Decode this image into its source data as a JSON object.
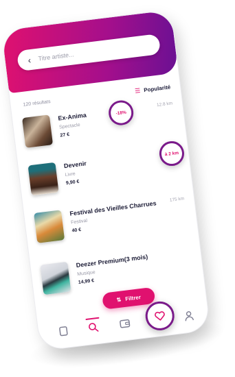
{
  "search": {
    "placeholder": "Titre artiste..."
  },
  "results": {
    "count": "120 résultats"
  },
  "sort": {
    "label": "Popularité"
  },
  "items": [
    {
      "title": "Ex-Anima",
      "category": "Spectacle",
      "price": "27 €",
      "distance": "12.8 km"
    },
    {
      "title": "Devenir",
      "category": "Livre",
      "price": "9,90 €",
      "distance": ""
    },
    {
      "title": "Festival des Vieilles Charrues",
      "category": "Festival",
      "price": "40 €",
      "distance": "175 km"
    },
    {
      "title": "Deezer Premium(3 mois)",
      "category": "Musique",
      "price": "14,99 €",
      "distance": ""
    }
  ],
  "badges": {
    "first": "-18%",
    "second": "à 2 km"
  },
  "filter": {
    "label": "Filtrer"
  },
  "nav": {
    "items": [
      "home",
      "search",
      "wallet",
      "favorites",
      "profile"
    ]
  },
  "colors": {
    "accent": "#e0116f",
    "purple": "#7a1a8a",
    "header_start": "#e0116f",
    "header_end": "#6a1093"
  }
}
